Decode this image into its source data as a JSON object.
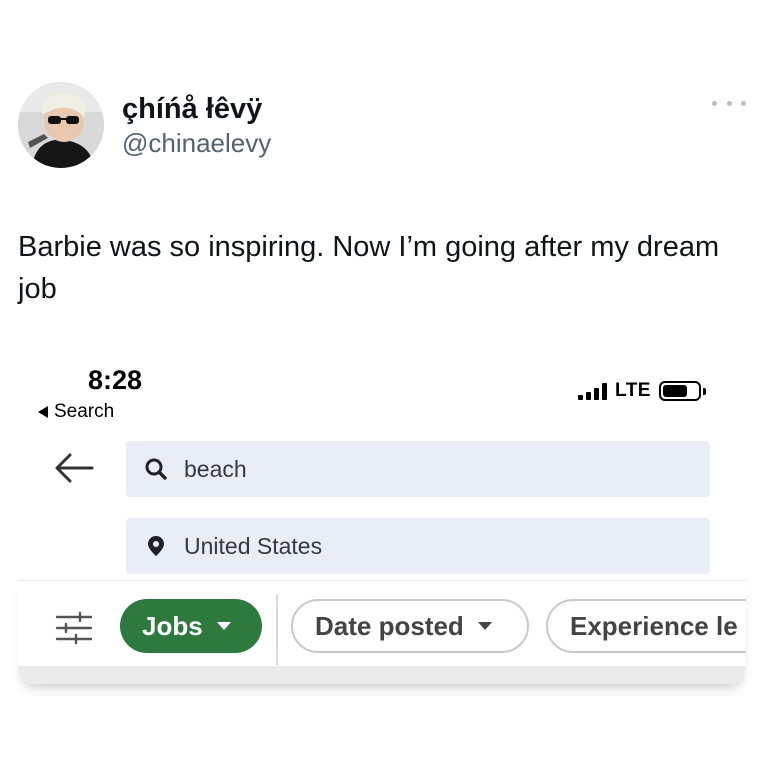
{
  "tweet": {
    "display_name": "çhíńå łêvÿ",
    "handle": "@chinaelevy",
    "more_icon": "more-horizontal-icon",
    "text": "Barbie was so inspiring. Now I’m going after my dream job"
  },
  "phone": {
    "status_bar": {
      "time": "8:28",
      "back_label": "Search",
      "network": "LTE",
      "signal_icon": "signal-bars-icon",
      "battery_icon": "battery-icon"
    },
    "search": {
      "back_icon": "back-arrow-icon",
      "keyword_icon": "search-icon",
      "keyword_value": "beach",
      "location_icon": "location-pin-icon",
      "location_value": "United States"
    },
    "filters": {
      "settings_icon": "filter-sliders-icon",
      "pills": [
        {
          "label": "Jobs",
          "active": true
        },
        {
          "label": "Date posted",
          "active": false
        },
        {
          "label": "Experience le",
          "active": false
        }
      ]
    },
    "colors": {
      "field_bg": "#e9edf6",
      "active_pill": "#2e7a3e"
    }
  }
}
